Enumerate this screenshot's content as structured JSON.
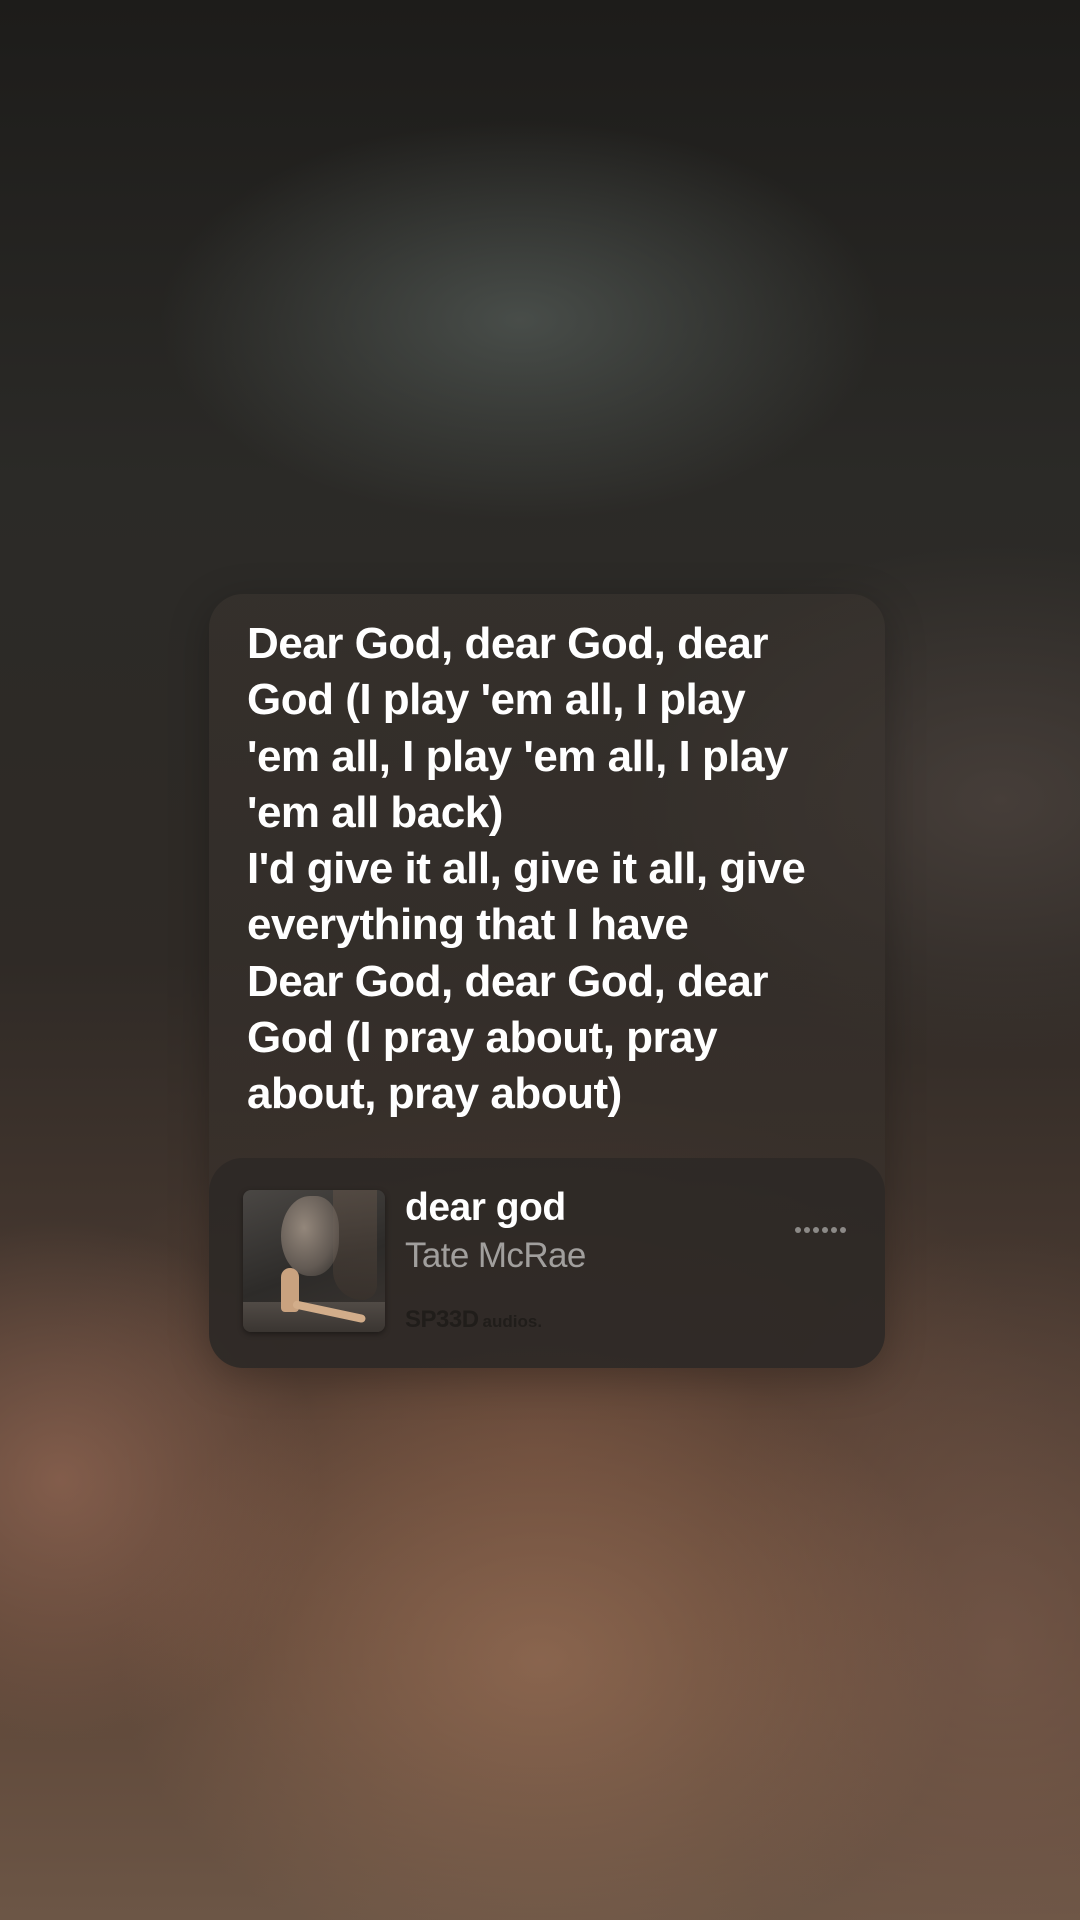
{
  "lyrics": {
    "lines": [
      "Dear God, dear God, dear",
      "God (I play 'em all, I play",
      "'em all, I play 'em all, I play",
      "'em all back)",
      "I'd give it all, give it all, give",
      "everything that I have",
      "Dear God, dear God, dear",
      "God (I pray about, pray",
      "about, pray about)"
    ]
  },
  "now_playing": {
    "title": "dear god",
    "artist": "Tate McRae",
    "source_brand": "SP33D",
    "source_suffix": "audios.",
    "artwork_icon": "album-artwork",
    "more_icon": "more-dots-icon"
  },
  "colors": {
    "text_primary": "#ffffff",
    "text_secondary": "rgba(255,255,255,0.55)",
    "card_bg": "#3a342f"
  }
}
